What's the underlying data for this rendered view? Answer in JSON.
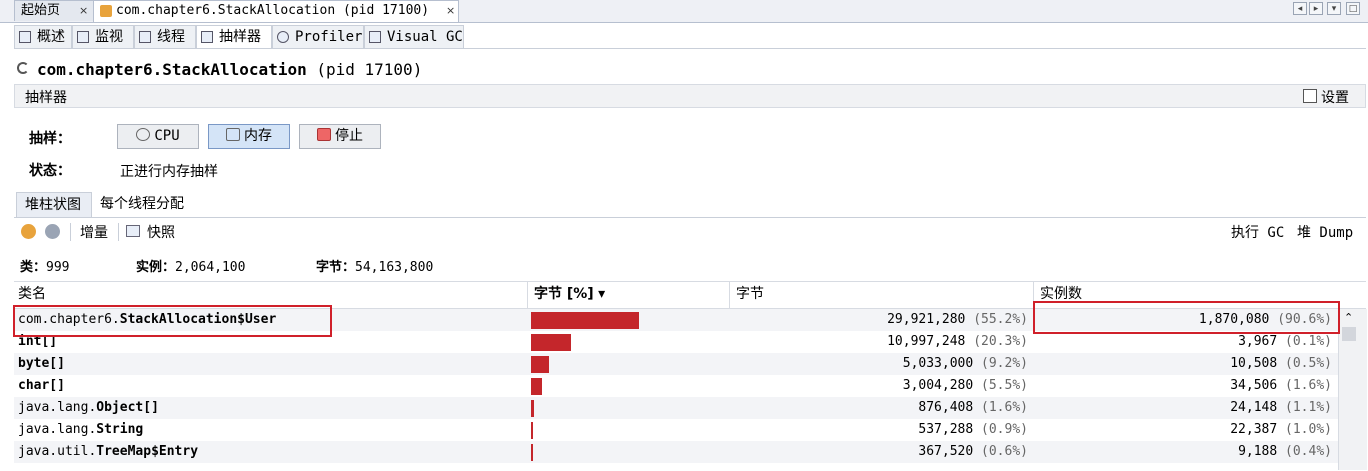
{
  "doc_tabs": [
    {
      "label": "起始页",
      "close": "×"
    },
    {
      "label": "com.chapter6.StackAllocation (pid 17100)",
      "close": "×"
    }
  ],
  "view_tabs": [
    "概述",
    "监视",
    "线程",
    "抽样器",
    "Profiler",
    "Visual GC"
  ],
  "title": {
    "main": "com.chapter6.StackAllocation",
    "pid": "(pid 17100)"
  },
  "sampler": {
    "header": "抽样器",
    "settings_label": "设置",
    "sample_label": "抽样：",
    "buttons": {
      "cpu": "CPU",
      "memory": "内存",
      "stop": "停止"
    },
    "status_label": "状态：",
    "status_value": "正进行内存抽样"
  },
  "sub_tabs": [
    "堆柱状图",
    "每个线程分配"
  ],
  "toolbar": {
    "delta": "增量",
    "snapshot": "快照",
    "gc": "执行 GC",
    "heapdump": "堆 Dump"
  },
  "stats": {
    "classes_label": "类：",
    "classes": "999",
    "instances_label": "实例：",
    "instances": "2,064,100",
    "bytes_label": "字节：",
    "bytes": "54,163,800"
  },
  "columns": {
    "name": "类名",
    "bytes_pct": "字节 [%]",
    "bytes": "字节",
    "instances": "实例数"
  },
  "rows": [
    {
      "prefix": "com.chapter6.",
      "cls": "StackAllocation$User",
      "bytes": "29,921,280",
      "bytes_pct": "(55.2%)",
      "inst": "1,870,080",
      "inst_pct": "(90.6%)",
      "share": 55.2
    },
    {
      "prefix": "",
      "cls": "int[]",
      "bytes": "10,997,248",
      "bytes_pct": "(20.3%)",
      "inst": "3,967",
      "inst_pct": "(0.1%)",
      "share": 20.3
    },
    {
      "prefix": "",
      "cls": "byte[]",
      "bytes": "5,033,000",
      "bytes_pct": "(9.2%)",
      "inst": "10,508",
      "inst_pct": "(0.5%)",
      "share": 9.2
    },
    {
      "prefix": "",
      "cls": "char[]",
      "bytes": "3,004,280",
      "bytes_pct": "(5.5%)",
      "inst": "34,506",
      "inst_pct": "(1.6%)",
      "share": 5.5
    },
    {
      "prefix": "java.lang.",
      "cls": "Object[]",
      "bytes": "876,408",
      "bytes_pct": "(1.6%)",
      "inst": "24,148",
      "inst_pct": "(1.1%)",
      "share": 1.6
    },
    {
      "prefix": "java.lang.",
      "cls": "String",
      "bytes": "537,288",
      "bytes_pct": "(0.9%)",
      "inst": "22,387",
      "inst_pct": "(1.0%)",
      "share": 0.9
    },
    {
      "prefix": "java.util.",
      "cls": "TreeMap$Entry",
      "bytes": "367,520",
      "bytes_pct": "(0.6%)",
      "inst": "9,188",
      "inst_pct": "(0.4%)",
      "share": 0.6
    }
  ],
  "colors": {
    "bar": "#c4262b",
    "highlight": "#d0202a"
  }
}
